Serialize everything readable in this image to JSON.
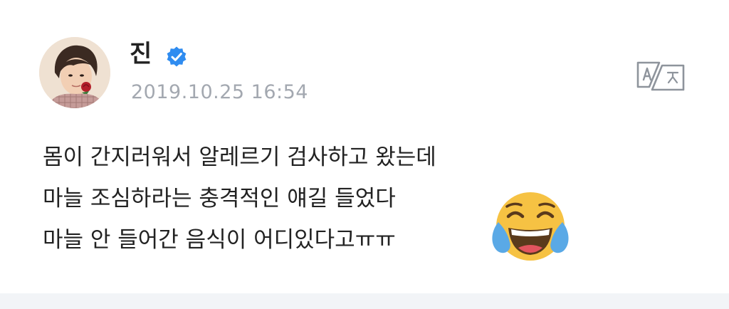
{
  "post": {
    "author_name": "진",
    "timestamp": "2019.10.25 16:54",
    "lines": [
      "몸이 간지러워서 알레르기 검사하고 왔는데",
      "마늘 조심하라는 충격적인 얘길 들었다",
      "마늘 안 들어간 음식이 어디있다고ㅠㅠ"
    ],
    "icons": {
      "verified": "verified-badge-icon",
      "translate": "translate-icon",
      "emoji": "tears-of-joy-emoji"
    },
    "colors": {
      "verified_blue": "#2f8cf0",
      "timestamp_gray": "#a3a8b0",
      "text": "#222222",
      "emoji_yellow": "#f6c243",
      "tear_blue": "#5aa9e6"
    }
  }
}
